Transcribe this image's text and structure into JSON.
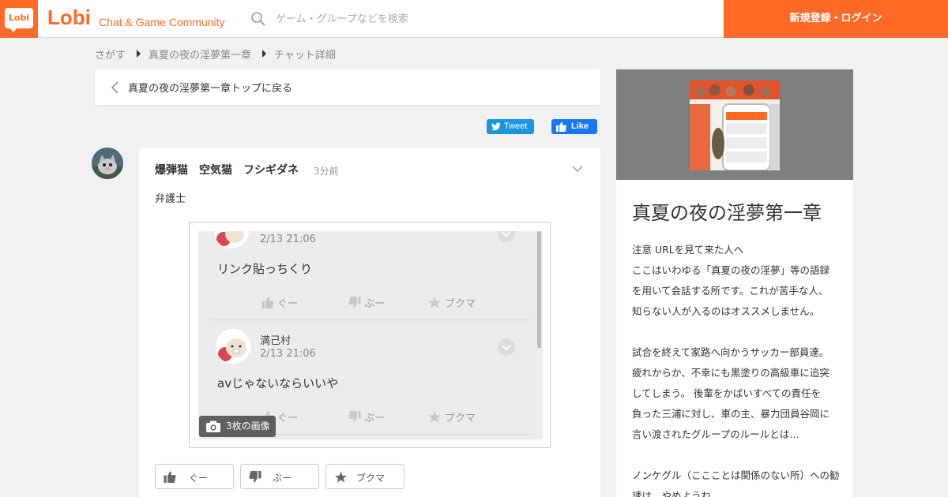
{
  "header": {
    "logo_text": "Lobi",
    "brand": "Lobi",
    "tagline": "Chat & Game Community",
    "search_placeholder": "ゲーム・グループなどを検索",
    "login_label": "新規登録・ログイン",
    "accent_color": "#ff6a27"
  },
  "breadcrumb": {
    "items": [
      "さがす",
      "真夏の夜の淫夢第一章",
      "チャット詳細"
    ]
  },
  "back": {
    "label": "真夏の夜の淫夢第一章トップに戻る"
  },
  "share": {
    "tweet_label": "Tweet",
    "like_label": "Like"
  },
  "message": {
    "author": "爆弾猫　空気猫　フシギダネ",
    "time": "3分前",
    "body": "弁護士",
    "image_count_label": "3枚の画像",
    "screenshot": {
      "post1": {
        "time": "2/13 21:06",
        "text": "リンク貼っちくり"
      },
      "post2": {
        "name": "満己村",
        "time": "2/13 21:06",
        "text": "avじゃないならいいや"
      },
      "actions": [
        "ぐー",
        "ぶー",
        "ブクマ"
      ]
    },
    "reactions": {
      "good": "ぐー",
      "boo": "ぶー",
      "bookmark": "ブクマ"
    }
  },
  "sidebar": {
    "title": "真夏の夜の淫夢第一章",
    "description": [
      "注意 URLを見て来た人へ",
      "ここはいわゆる「真夏の夜の淫夢」等の語録",
      "を用いて会話する所です。これが苦手な人、",
      "知らない人が入るのはオススメしません。",
      "",
      "試合を終えて家路へ向かうサッカー部員達。",
      "疲れからか、不幸にも黒塗りの高級車に追突",
      "してしまう。 後輩をかばいすべての責任を",
      "負った三浦に対し、車の主、暴力団員谷岡に",
      "言い渡されたグループのルールとは…",
      "",
      "ノンケグル（ここことは関係のない所）への勧",
      "誘は…やめようね"
    ]
  }
}
